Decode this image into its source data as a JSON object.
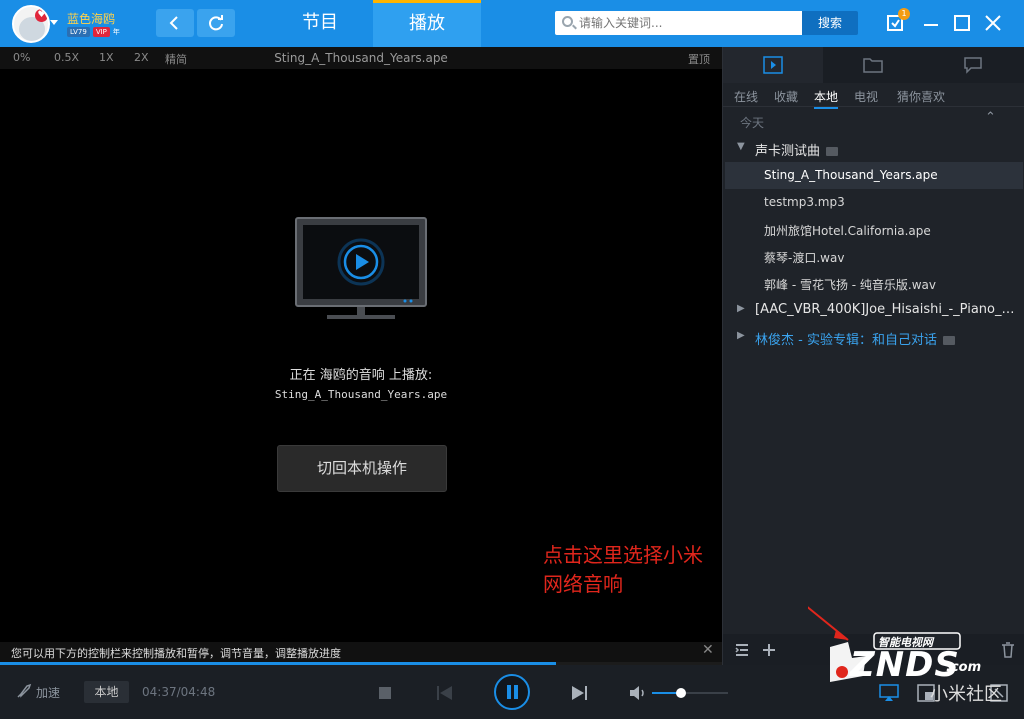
{
  "user": {
    "name": "蓝色海鸥",
    "level": "LV79",
    "vip": "VIP",
    "year": "年"
  },
  "topnav": {
    "tabs": [
      {
        "label": "节目"
      },
      {
        "label": "播放"
      }
    ]
  },
  "search": {
    "placeholder": "请输入关键词...",
    "button": "搜索",
    "notification_count": "1"
  },
  "player": {
    "speeds": [
      "0%",
      "0.5X",
      "1X",
      "2X",
      "精简"
    ],
    "file_title": "Sting_A_Thousand_Years.ape",
    "pin_label": "置顶",
    "status_text": "正在 海鸥的音响 上播放:",
    "status_file": "Sting_A_Thousand_Years.ape",
    "back_button": "切回本机操作",
    "annotation": "点击这里选择小米网络音响",
    "tip": "您可以用下方的控制栏来控制播放和暂停，调节音量，调整播放进度",
    "progress_fraction": 0.77
  },
  "panel": {
    "subtabs": [
      "在线",
      "收藏",
      "本地",
      "电视",
      "猜你喜欢"
    ],
    "active_subtab": "本地",
    "section": "今天",
    "folders": [
      {
        "name": "声卡测试曲",
        "expanded": true,
        "songs": [
          "Sting_A_Thousand_Years.ape",
          "testmp3.mp3",
          "加州旅馆Hotel.California.ape",
          "蔡琴-渡口.wav",
          "郭峰 - 雪花飞扬 - 纯音乐版.wav"
        ]
      },
      {
        "name": "[AAC_VBR_400K]Joe_Hisaishi_-_Piano_…",
        "expanded": false
      },
      {
        "name": "林俊杰 - 实验专辑：和自己对话",
        "expanded": false
      }
    ]
  },
  "controls": {
    "speed_up": "加速",
    "local": "本地",
    "time": "04:37/04:48",
    "volume_fraction": 0.38
  },
  "watermark": {
    "logo": "ZNDS",
    "domain": ".com",
    "tagline": "智能电视网",
    "sub": "小米社区"
  },
  "colors": {
    "topbar": "#1a8ee6",
    "accent": "#1a8ee6",
    "annotation": "#e0261c",
    "active_tab_border": "#ffb400"
  }
}
